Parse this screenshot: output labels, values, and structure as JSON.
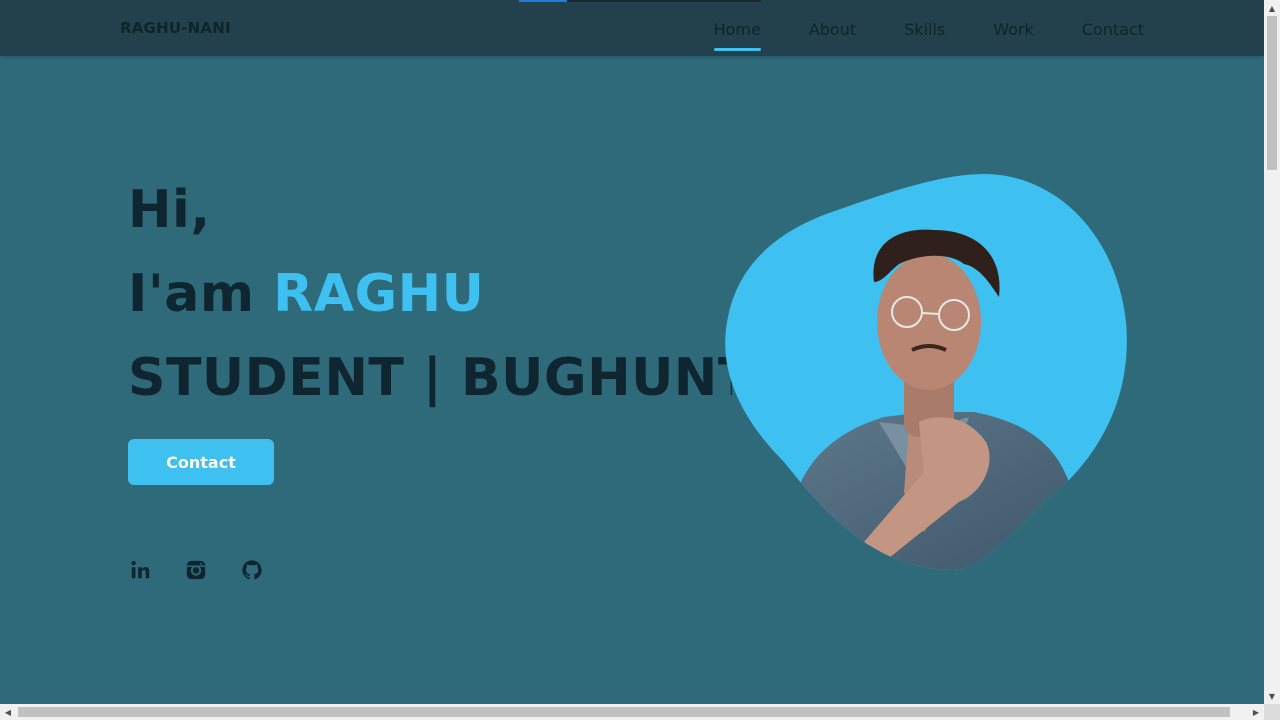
{
  "header": {
    "brand": "RAGHU-NANI",
    "nav": [
      {
        "label": "Home",
        "active": true
      },
      {
        "label": "About",
        "active": false
      },
      {
        "label": "Skills",
        "active": false
      },
      {
        "label": "Work",
        "active": false
      },
      {
        "label": "Contact",
        "active": false
      }
    ],
    "scroll_progress": 0.2
  },
  "hero": {
    "greeting": "Hi,",
    "intro_prefix": "I'am ",
    "name": "RAGHU",
    "role": "STUDENT | BUGHUNTER",
    "contact_button": "Contact",
    "socials": [
      "linkedin-icon",
      "instagram-icon",
      "github-icon"
    ]
  },
  "colors": {
    "accent": "#3ec0f0",
    "background": "#2e6a7a",
    "header": "#22414c",
    "text_dark": "#0f2630"
  }
}
